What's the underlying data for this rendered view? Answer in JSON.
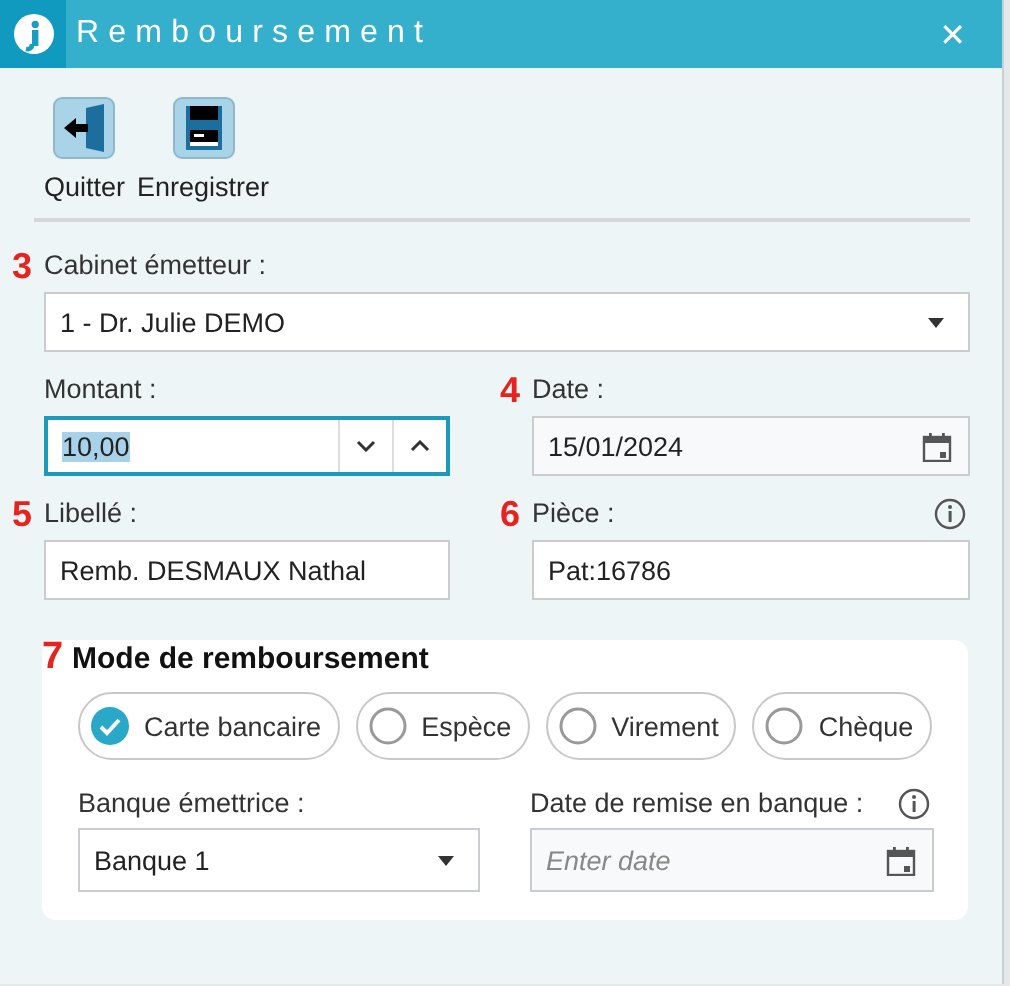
{
  "window": {
    "title": "Remboursement",
    "close": "✕"
  },
  "toolbar": [
    {
      "label": "Quitter",
      "kind": "exit"
    },
    {
      "label": "Enregistrer",
      "kind": "save"
    }
  ],
  "fields": [
    {
      "marker": "3",
      "label": "Cabinet émetteur :",
      "kind": "select",
      "value": "1 - Dr. Julie DEMO"
    },
    {
      "label": "Montant :",
      "kind": "spinner",
      "value": "10,00",
      "focused": true
    },
    {
      "marker": "4",
      "label": "Date :",
      "kind": "date",
      "value": "15/01/2024"
    },
    {
      "marker": "5",
      "label": "Libellé :",
      "kind": "text",
      "value": "Remb. DESMAUX Nathal"
    },
    {
      "marker": "6",
      "label": "Pièce :",
      "kind": "text",
      "value": "Pat:16786",
      "info": true
    }
  ],
  "payment": {
    "marker": "7",
    "title": "Mode de remboursement",
    "options": [
      {
        "label": "Carte bancaire",
        "selected": true
      },
      {
        "label": "Espèce",
        "selected": false
      },
      {
        "label": "Virement",
        "selected": false
      },
      {
        "label": "Chèque",
        "selected": false
      }
    ],
    "fields": [
      {
        "label": "Banque émettrice :",
        "kind": "select",
        "value": "Banque  1"
      },
      {
        "label": "Date de remise en banque :",
        "kind": "date",
        "placeholder": "Enter date",
        "info": true
      }
    ]
  }
}
